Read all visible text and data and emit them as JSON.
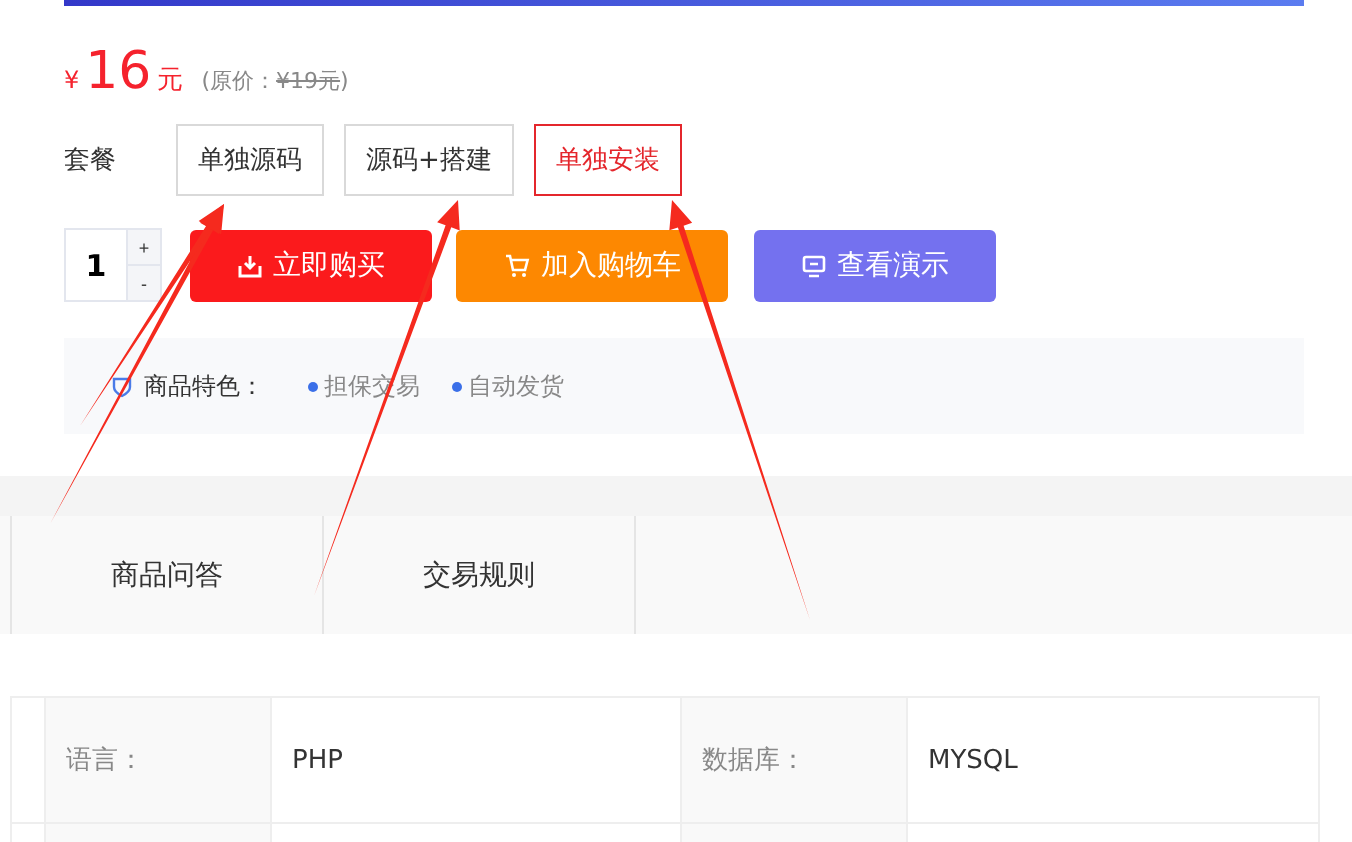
{
  "price": {
    "currency": "¥",
    "amount": "16",
    "unit": "元",
    "original_prefix": "(原价：",
    "original": "¥19元",
    "original_suffix": ")"
  },
  "packages": {
    "label": "套餐",
    "options": [
      {
        "label": "单独源码",
        "selected": false
      },
      {
        "label": "源码+搭建",
        "selected": false
      },
      {
        "label": "单独安装",
        "selected": true
      }
    ]
  },
  "quantity": {
    "value": "1",
    "plus": "+",
    "minus": "-"
  },
  "actions": [
    {
      "kind": "buy",
      "label": "立即购买"
    },
    {
      "kind": "cart",
      "label": "加入购物车"
    },
    {
      "kind": "demo",
      "label": "查看演示"
    }
  ],
  "features": {
    "label": "商品特色：",
    "items": [
      "担保交易",
      "自动发货"
    ]
  },
  "tabs": [
    {
      "label": "商品问答"
    },
    {
      "label": "交易规则"
    }
  ],
  "specs": [
    {
      "label": "语言：",
      "value": "PHP"
    },
    {
      "label": "数据库：",
      "value": "MYSQL"
    }
  ]
}
